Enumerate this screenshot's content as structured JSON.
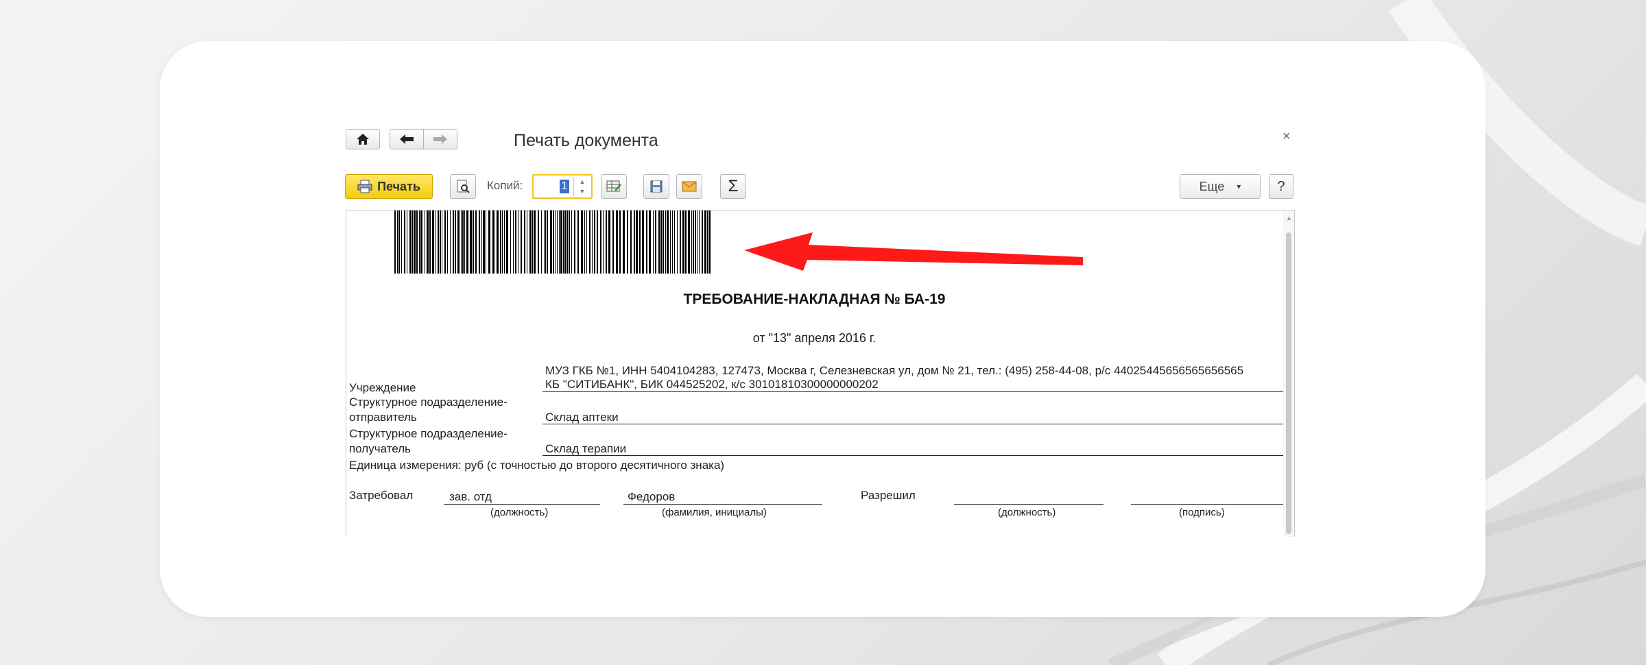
{
  "window": {
    "title": "Печать документа",
    "close_glyph": "×"
  },
  "toolbar": {
    "print_label": "Печать",
    "copies_label": "Копий:",
    "copies_value": "1",
    "more_label": "Еще",
    "help_label": "?",
    "sum_glyph": "Σ",
    "more_arrow": "▾"
  },
  "document": {
    "title": "ТРЕБОВАНИЕ-НАКЛАДНАЯ № БА-19",
    "date_line": "от \"13\" апреля 2016 г.",
    "institution_label": "Учреждение",
    "institution_line1": "МУЗ ГКБ №1, ИНН 5404104283, 127473, Москва г, Селезневская ул, дом № 21, тел.: (495) 258-44-08, р/с 44025445656565656565",
    "institution_line2": "КБ \"СИТИБАНК\", БИК 044525202, к/с 30101810300000000202",
    "sender_label_1": "Структурное подразделение-",
    "sender_label_2": "отправитель",
    "sender_value": "Склад аптеки",
    "receiver_label_1": "Структурное подразделение-",
    "receiver_label_2": "получатель",
    "receiver_value": "Склад терапии",
    "unit_line": "Единица измерения: руб (с точностью до второго десятичного знака)",
    "requested_label": "Затребовал",
    "requested_position": "зав. отд",
    "requested_name": "Федоров",
    "caption_position": "(должность)",
    "caption_name": "(фамилия, инициалы)",
    "approved_label": "Разрешил",
    "caption_position_2": "(должность)",
    "caption_signature": "(подпись)"
  },
  "icons": {
    "home": "home-icon",
    "back": "arrow-left-icon",
    "forward": "arrow-right-icon",
    "printer": "printer-icon",
    "preview": "print-preview-icon",
    "edit_table": "table-edit-icon",
    "save": "save-icon",
    "email": "envelope-icon",
    "sum": "sigma-icon",
    "close": "close-icon",
    "barcode": "barcode-image",
    "annotation_arrow": "red-arrow-annotation"
  },
  "colors": {
    "print_button": "#f5cc10",
    "copies_focus_border": "#f0c419",
    "annotation_arrow": "#ff1a1a"
  }
}
